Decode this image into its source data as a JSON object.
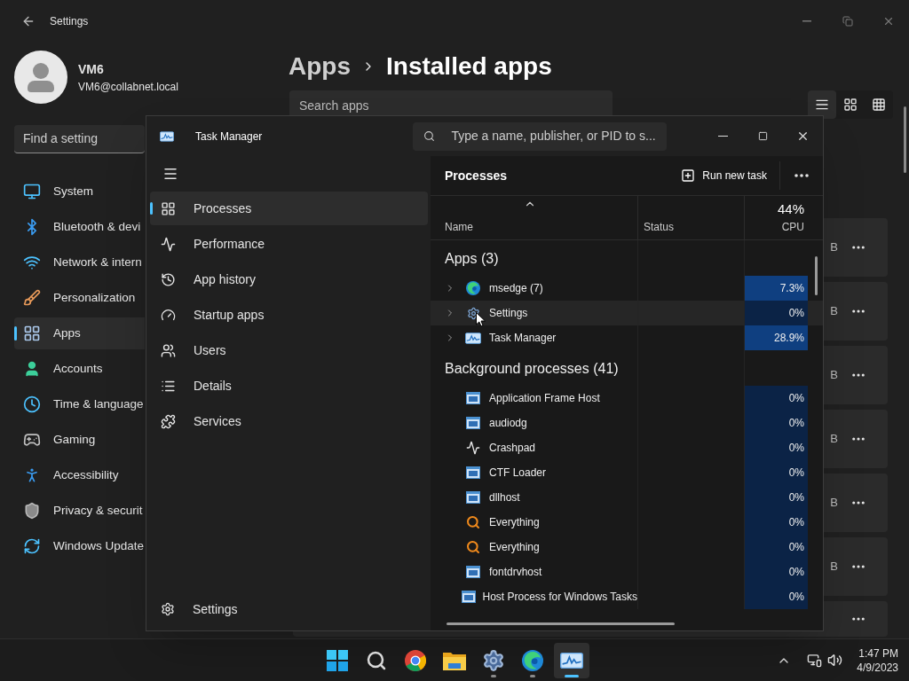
{
  "settings": {
    "title": "Settings",
    "user": {
      "name": "VM6",
      "email": "VM6@collabnet.local"
    },
    "search": {
      "placeholder": "Find a setting"
    },
    "nav": [
      {
        "label": "System",
        "selected": false
      },
      {
        "label": "Bluetooth & devi",
        "selected": false
      },
      {
        "label": "Network & intern",
        "selected": false
      },
      {
        "label": "Personalization",
        "selected": false
      },
      {
        "label": "Apps",
        "selected": true
      },
      {
        "label": "Accounts",
        "selected": false
      },
      {
        "label": "Time & language",
        "selected": false
      },
      {
        "label": "Gaming",
        "selected": false
      },
      {
        "label": "Accessibility",
        "selected": false
      },
      {
        "label": "Privacy & securit",
        "selected": false
      },
      {
        "label": "Windows Update",
        "selected": false
      }
    ],
    "breadcrumb": {
      "parent": "Apps",
      "current": "Installed apps"
    },
    "app_search": {
      "placeholder": "Search apps"
    },
    "views": [
      {
        "selected": true
      },
      {
        "selected": false
      },
      {
        "selected": false
      }
    ],
    "app_cards": [
      {
        "kind": "full",
        "size": "B"
      },
      {
        "kind": "full",
        "size": "B"
      },
      {
        "kind": "full",
        "size": "B"
      },
      {
        "kind": "full",
        "size": "B"
      },
      {
        "kind": "full",
        "size": "B"
      },
      {
        "kind": "full",
        "size": "B"
      },
      {
        "kind": "partial"
      }
    ]
  },
  "task_manager": {
    "title": "Task Manager",
    "search": {
      "placeholder": "Type a name, publisher, or PID to s..."
    },
    "nav": [
      {
        "label": "Processes",
        "selected": true
      },
      {
        "label": "Performance",
        "selected": false
      },
      {
        "label": "App history",
        "selected": false
      },
      {
        "label": "Startup apps",
        "selected": false
      },
      {
        "label": "Users",
        "selected": false
      },
      {
        "label": "Details",
        "selected": false
      },
      {
        "label": "Services",
        "selected": false
      }
    ],
    "settings_label": "Settings",
    "page_title": "Processes",
    "run_task": "Run new task",
    "columns": {
      "name": "Name",
      "status": "Status",
      "cpu_total": "44%",
      "cpu": "CPU"
    },
    "groups": [
      {
        "title": "Apps (3)",
        "rows": [
          {
            "kind": "edge",
            "name": "msedge (7)",
            "cpu": "7.3%",
            "expandable": true,
            "hovered": false,
            "busy": true
          },
          {
            "kind": "gear",
            "name": "Settings",
            "cpu": "0%",
            "expandable": true,
            "hovered": true,
            "busy": false
          },
          {
            "kind": "chart",
            "name": "Task Manager",
            "cpu": "28.9%",
            "expandable": true,
            "hovered": false,
            "busy": true
          }
        ]
      },
      {
        "title": "Background processes (41)",
        "rows": [
          {
            "kind": "window",
            "name": "Application Frame Host",
            "cpu": "0%",
            "expandable": false,
            "hovered": false,
            "busy": false
          },
          {
            "kind": "window",
            "name": "audiodg",
            "cpu": "0%",
            "expandable": false,
            "hovered": false,
            "busy": false
          },
          {
            "kind": "pulse",
            "name": "Crashpad",
            "cpu": "0%",
            "expandable": false,
            "hovered": false,
            "busy": false
          },
          {
            "kind": "window",
            "name": "CTF Loader",
            "cpu": "0%",
            "expandable": false,
            "hovered": false,
            "busy": false
          },
          {
            "kind": "window",
            "name": "dllhost",
            "cpu": "0%",
            "expandable": false,
            "hovered": false,
            "busy": false
          },
          {
            "kind": "magnifier",
            "name": "Everything",
            "cpu": "0%",
            "expandable": false,
            "hovered": false,
            "busy": false
          },
          {
            "kind": "magnifier",
            "name": "Everything",
            "cpu": "0%",
            "expandable": false,
            "hovered": false,
            "busy": false
          },
          {
            "kind": "window",
            "name": "fontdrvhost",
            "cpu": "0%",
            "expandable": false,
            "hovered": false,
            "busy": false
          },
          {
            "kind": "window",
            "name": "Host Process for Windows Tasks",
            "cpu": "0%",
            "expandable": false,
            "hovered": false,
            "busy": false
          }
        ]
      }
    ]
  },
  "taskbar": {
    "apps": [
      {
        "kind": "start",
        "selected": false,
        "running": false
      },
      {
        "kind": "search",
        "selected": false,
        "running": false
      },
      {
        "kind": "chrome",
        "selected": false,
        "running": false
      },
      {
        "kind": "folder",
        "selected": false,
        "running": false
      },
      {
        "kind": "gear",
        "selected": false,
        "running": true
      },
      {
        "kind": "edge",
        "selected": false,
        "running": true
      },
      {
        "kind": "chart",
        "selected": true,
        "running": true
      }
    ],
    "time": "1:47 PM",
    "date": "4/9/2023"
  }
}
